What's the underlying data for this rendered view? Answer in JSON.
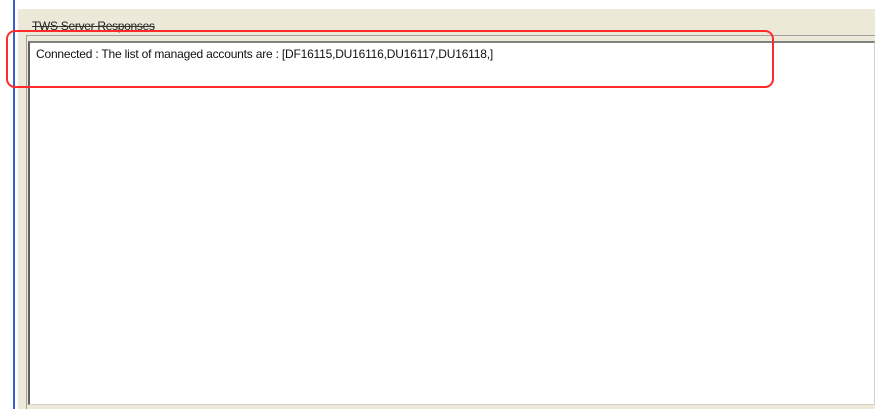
{
  "panel": {
    "title": "TWS Server Responses"
  },
  "responses": {
    "items": [
      {
        "text": "Connected : The list of managed accounts are : [DF16115,DU16116,DU16117,DU16118,]"
      }
    ]
  },
  "colors": {
    "highlight": "#ff2b2b",
    "panel_background": "#ece9d8",
    "accent_line": "#3a5fcd"
  }
}
